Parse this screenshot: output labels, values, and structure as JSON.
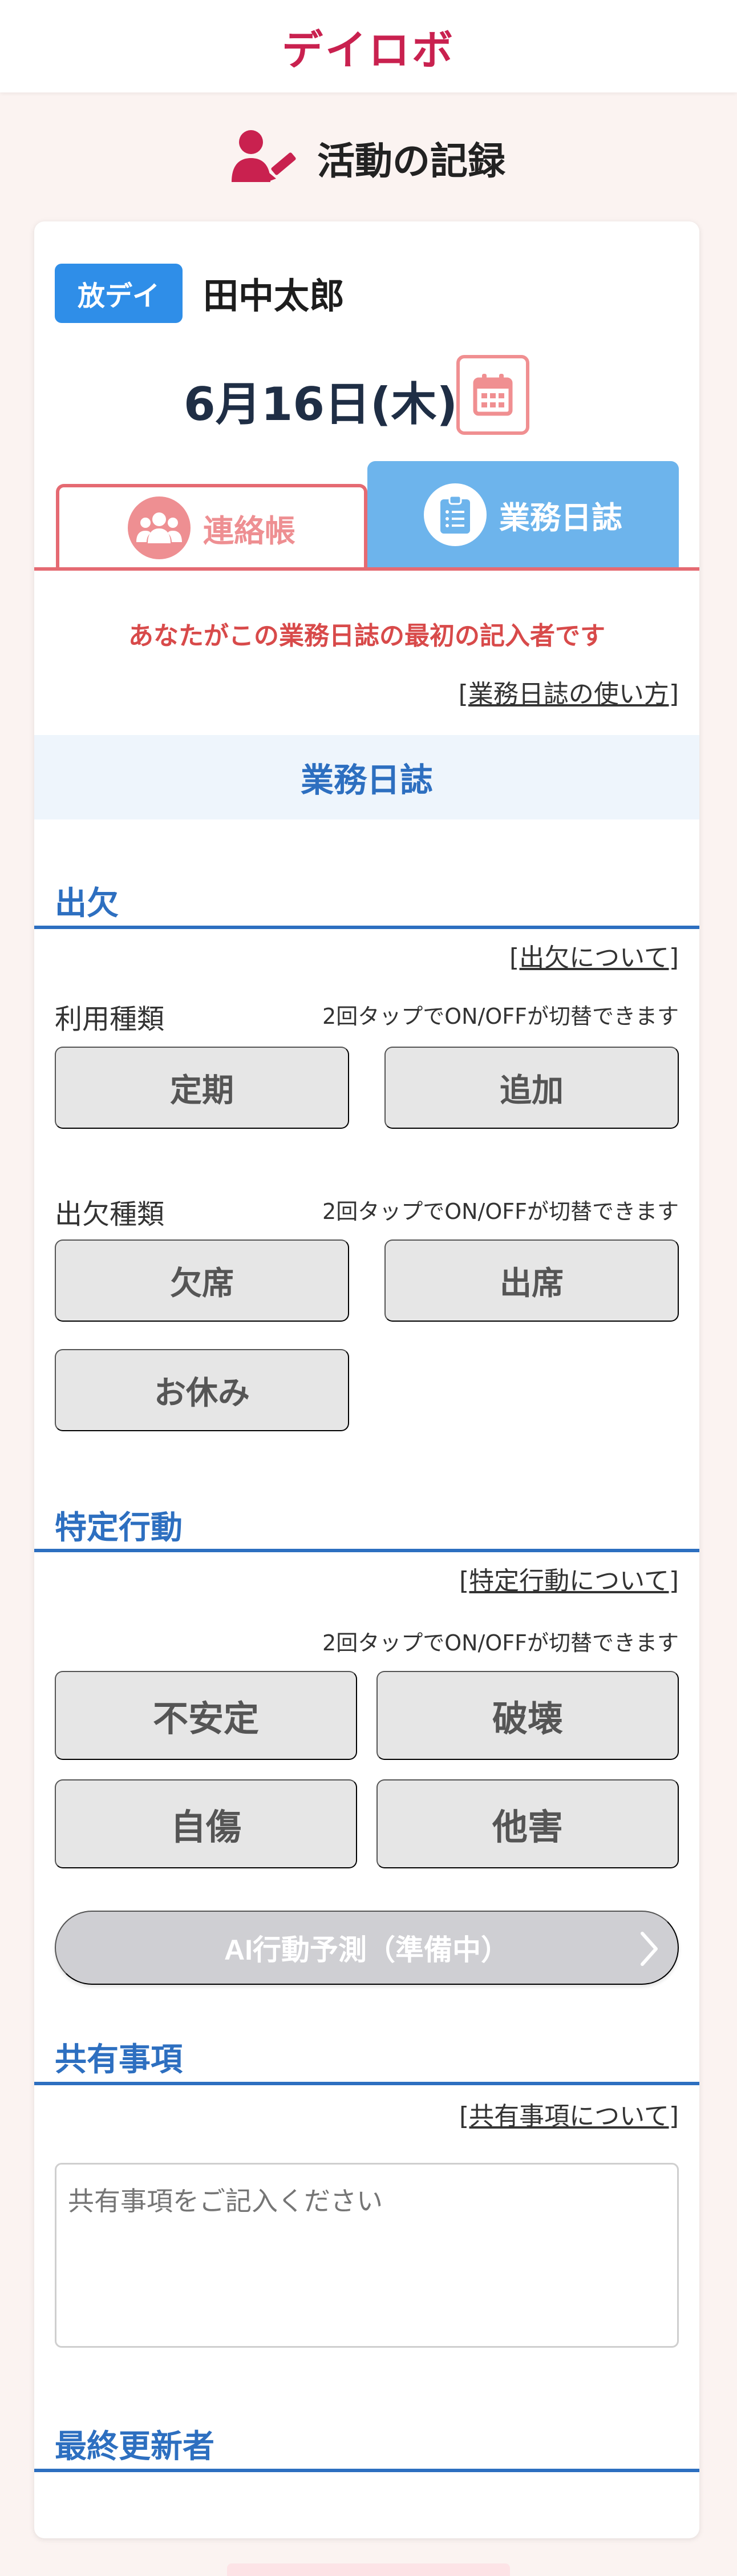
{
  "app": {
    "brand": "デイロボ"
  },
  "page": {
    "title": "活動の記録",
    "icon": "user-pen-icon"
  },
  "child": {
    "service_badge": "放デイ",
    "name": "田中太郎",
    "date": "6月16日(木)"
  },
  "tabs": [
    {
      "label": "連絡帳",
      "icon": "group-icon",
      "active": false
    },
    {
      "label": "業務日誌",
      "icon": "clipboard-icon",
      "active": true
    }
  ],
  "notice": "あなたがこの業務日誌の最初の記入者です",
  "help_links": {
    "diary": "[業務日誌の使い方]",
    "attendance": "[出欠について]",
    "behavior": "[特定行動について]",
    "shared": "[共有事項について]"
  },
  "diary_header": "業務日誌",
  "attendance": {
    "title": "出欠",
    "usage_label": "利用種類",
    "usage_hint": "2回タップでON/OFFが切替できます",
    "usage_options": [
      "定期",
      "追加"
    ],
    "type_label": "出欠種類",
    "type_hint": "2回タップでON/OFFが切替できます",
    "type_options": [
      "欠席",
      "出席",
      "お休み"
    ]
  },
  "behavior": {
    "title": "特定行動",
    "hint": "2回タップでON/OFFが切替できます",
    "options": [
      "不安定",
      "破壊",
      "自傷",
      "他害"
    ],
    "ai_button": "AI行動予測（準備中）"
  },
  "shared": {
    "title": "共有事項",
    "placeholder": "共有事項をご記入ください"
  },
  "last_updater": {
    "title": "最終更新者"
  },
  "colors": {
    "brand": "#c9214f",
    "accent_blue": "#2d6fc0",
    "badge_blue": "#2f8ee8",
    "tab_active": "#6db4ec",
    "tab_inactive_border": "#e56a72",
    "notice_red": "#d84a4a"
  }
}
